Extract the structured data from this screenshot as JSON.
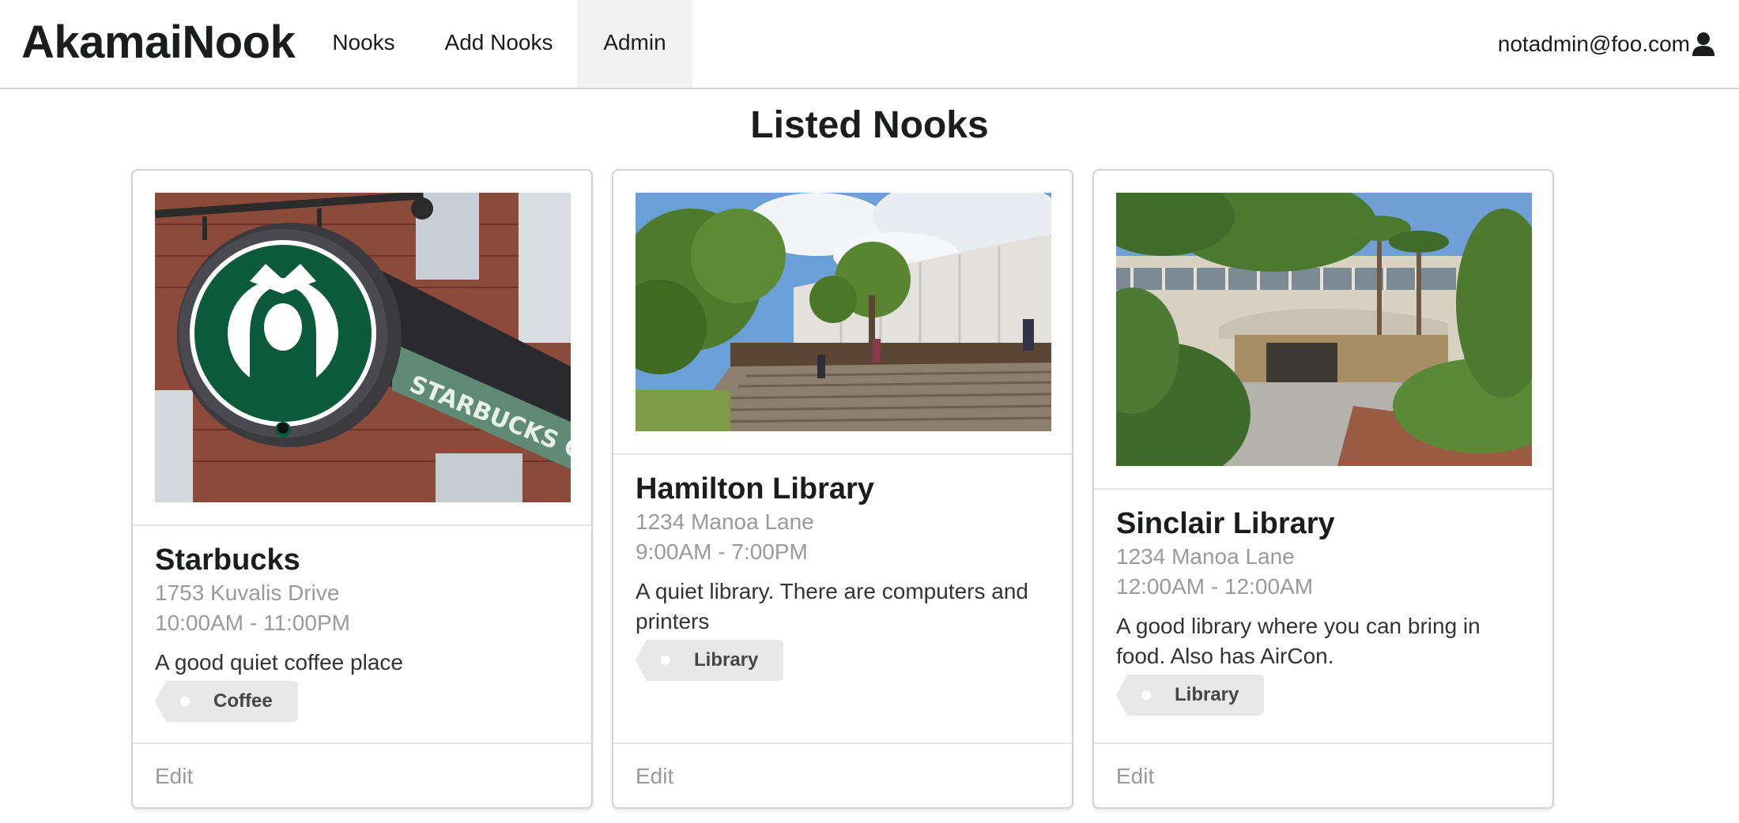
{
  "app": {
    "brand": "AkamaiNook"
  },
  "nav": {
    "items": [
      {
        "label": "Nooks"
      },
      {
        "label": "Add Nooks"
      },
      {
        "label": "Admin",
        "active": true
      }
    ],
    "user": {
      "email": "notadmin@foo.com",
      "icon": "user-icon"
    }
  },
  "page": {
    "title": "Listed Nooks"
  },
  "cards": [
    {
      "name": "Starbucks",
      "address": "1753 Kuvalis Drive",
      "hours": "10:00AM - 11:00PM",
      "description": "A good quiet coffee place",
      "tag": "Coffee",
      "action": "Edit",
      "image_alt": "Starbucks sign"
    },
    {
      "name": "Hamilton Library",
      "address": "1234 Manoa Lane",
      "hours": "9:00AM - 7:00PM",
      "description": "A quiet library. There are computers and printers",
      "tag": "Library",
      "action": "Edit",
      "image_alt": "Hamilton Library building"
    },
    {
      "name": "Sinclair Library",
      "address": "1234 Manoa Lane",
      "hours": "12:00AM - 12:00AM",
      "description": "A good library where you can bring in food. Also has AirCon.",
      "tag": "Library",
      "action": "Edit",
      "image_alt": "Sinclair Library entrance"
    }
  ],
  "colors": {
    "border": "#d4d4d5",
    "active_nav_bg": "#f2f2f2",
    "meta_text": "#9a9a9a",
    "tag_bg": "#e8e8e8",
    "starbucks_green": "#0b5a3c"
  }
}
